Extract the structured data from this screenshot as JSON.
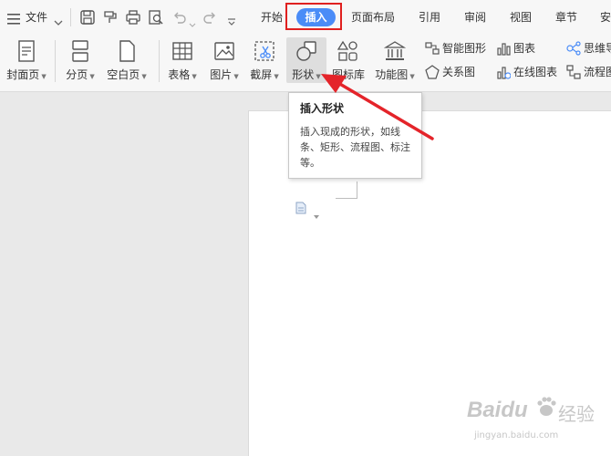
{
  "menu": {
    "hamburger_icon": "hamburger-icon",
    "file_label": "文件"
  },
  "tabs": [
    {
      "label": "开始"
    },
    {
      "label": "插入",
      "selected": true
    },
    {
      "label": "页面布局"
    },
    {
      "label": "引用"
    },
    {
      "label": "审阅"
    },
    {
      "label": "视图"
    },
    {
      "label": "章节"
    },
    {
      "label": "安"
    }
  ],
  "ribbon": {
    "cover_page": "封面页",
    "page_break": "分页",
    "blank_page": "空白页",
    "table": "表格",
    "picture": "图片",
    "screenshot": "截屏",
    "shapes": "形状",
    "icon_library": "图标库",
    "function_chart": "功能图",
    "smart_graphic": "智能图形",
    "chart": "图表",
    "relation_chart": "关系图",
    "online_chart": "在线图表",
    "mind_map": "思维导",
    "flowchart": "流程图"
  },
  "tooltip": {
    "title": "插入形状",
    "body": "插入现成的形状，如线条、矩形、流程图、标注等。"
  },
  "watermark": {
    "brand": "Baidu",
    "suffix": "经验",
    "url": "jingyan.baidu.com"
  },
  "colors": {
    "tab_selected_bg": "#4a8cf7",
    "highlight_box": "#e0201f",
    "arrow": "#e4242a",
    "ribbon_bg": "#f7f7f7",
    "canvas_bg": "#e9e9e9"
  }
}
